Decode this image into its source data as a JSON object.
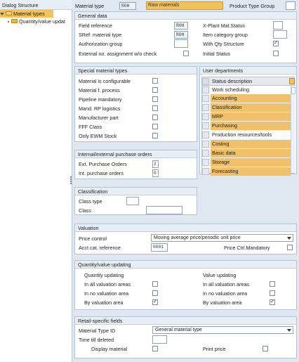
{
  "left": {
    "title": "Dialog Structure",
    "items": [
      {
        "label": "Material types"
      },
      {
        "label": "Quantity/value updat"
      }
    ]
  },
  "top": {
    "material_type_label": "Material type",
    "material_type_code": "ROH",
    "material_type_desc": "Raw materials",
    "product_type_group_label": "Product Type Group"
  },
  "general": {
    "title": "General data",
    "field_reference_label": "Field reference",
    "field_reference_value": "ROH",
    "sref_label": "SRef: material type",
    "sref_value": "ROH",
    "auth_group_label": "Authorization group",
    "ext_no_label": "External no. assignment w/o check",
    "xplant_label": "X-Plant Mat.Status",
    "item_cat_label": "Item category group",
    "with_qty_label": "With Qty Structure",
    "with_qty_checked": "✓",
    "initial_status_label": "Initial Status"
  },
  "special": {
    "title": "Special material types",
    "items": [
      {
        "label": "Material is configurable"
      },
      {
        "label": "Material f. process"
      },
      {
        "label": "Pipeline mandatory"
      },
      {
        "label": "Mand. RP logistics"
      },
      {
        "label": "Manufacturer part"
      },
      {
        "label": "FFF Class"
      },
      {
        "label": "Only EWM Stock"
      }
    ]
  },
  "departments": {
    "title": "User departments",
    "header": "Status description",
    "rows": [
      {
        "label": "Work scheduling",
        "selected": false
      },
      {
        "label": "Accounting",
        "selected": true
      },
      {
        "label": "Classification",
        "selected": true
      },
      {
        "label": "MRP",
        "selected": true
      },
      {
        "label": "Purchasing",
        "selected": true
      },
      {
        "label": "Production resources/tools",
        "selected": false
      },
      {
        "label": "Costing",
        "selected": true
      },
      {
        "label": "Basic data",
        "selected": true
      },
      {
        "label": "Storage",
        "selected": true
      },
      {
        "label": "Forecasting",
        "selected": true
      }
    ]
  },
  "purchase": {
    "title": "Internal/external purchase orders",
    "ext_label": "Ext. Purchase Orders",
    "ext_value": "2",
    "int_label": "Int. purchase orders",
    "int_value": "0"
  },
  "classification": {
    "title": "Classification",
    "class_type_label": "Class type",
    "class_label": "Class"
  },
  "valuation": {
    "title": "Valuation",
    "price_control_label": "Price control",
    "price_control_value": "Moving average price/periodic unit price",
    "acct_cat_label": "Acct cat. reference",
    "acct_cat_value": "0001",
    "price_ctrl_mandatory_label": "Price Ctrl.Mandatory"
  },
  "qty_value": {
    "title": "Quantity/value updating",
    "qty_heading": "Quantity updating",
    "val_heading": "Value updating",
    "row1": "In all valuation areas",
    "row2": "In no valuation area",
    "row3": "By valuation area",
    "checked": "✓"
  },
  "retail": {
    "title": "Retail-specific fields",
    "mat_type_id_label": "Material Type ID",
    "mat_type_id_value": "General material type",
    "time_till_deleted_label": "Time till deleted",
    "display_material_label": "Display material",
    "print_price_label": "Print price"
  }
}
